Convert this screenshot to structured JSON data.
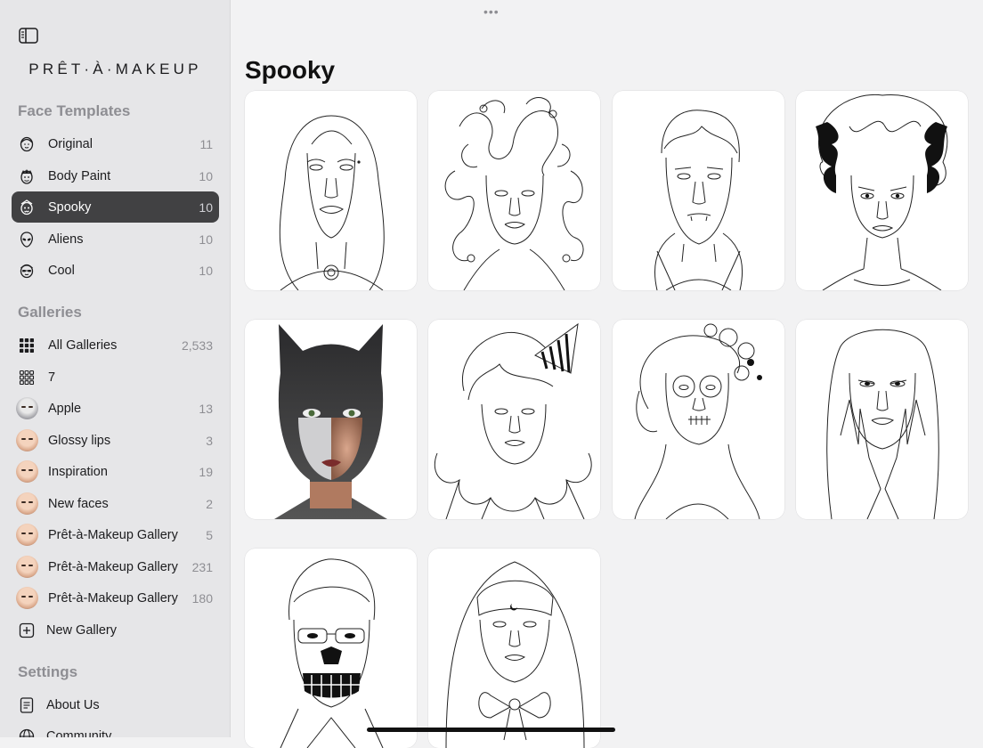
{
  "brand": "PRÊT-À-MAKEUP",
  "brand_display": "PRÊT·À·MAKEUP",
  "sections": {
    "face_templates": "Face Templates",
    "galleries": "Galleries",
    "settings": "Settings"
  },
  "face_templates": [
    {
      "label": "Original",
      "count": "11",
      "icon": "face-outline-icon"
    },
    {
      "label": "Body Paint",
      "count": "10",
      "icon": "body-paint-icon"
    },
    {
      "label": "Spooky",
      "count": "10",
      "icon": "spooky-face-icon",
      "selected": true
    },
    {
      "label": "Aliens",
      "count": "10",
      "icon": "alien-face-icon"
    },
    {
      "label": "Cool",
      "count": "10",
      "icon": "cool-face-icon"
    }
  ],
  "galleries": [
    {
      "label": "All Galleries",
      "count": "2,533",
      "icon": "grid-icon"
    },
    {
      "label": "7",
      "count": "",
      "icon": "grid-outline-icon"
    },
    {
      "label": "Apple",
      "count": "13",
      "icon": "avatar"
    },
    {
      "label": "Glossy lips",
      "count": "3",
      "icon": "avatar"
    },
    {
      "label": "Inspiration",
      "count": "19",
      "icon": "avatar"
    },
    {
      "label": "New faces",
      "count": "2",
      "icon": "avatar"
    },
    {
      "label": "Prêt-à-Makeup Gallery",
      "count": "5",
      "icon": "avatar"
    },
    {
      "label": "Prêt-à-Makeup Gallery",
      "count": "231",
      "icon": "avatar"
    },
    {
      "label": "Prêt-à-Makeup Gallery",
      "count": "180",
      "icon": "avatar"
    }
  ],
  "new_gallery": "New Gallery",
  "settings": [
    {
      "label": "About Us",
      "icon": "document-icon"
    },
    {
      "label": "Community",
      "icon": "globe-icon"
    }
  ],
  "main": {
    "title": "Spooky",
    "more_label": "•••",
    "templates": [
      {
        "name": "vampire-woman"
      },
      {
        "name": "medusa"
      },
      {
        "name": "vampire-man"
      },
      {
        "name": "bride-of-frankenstein"
      },
      {
        "name": "cat-skull-makeup"
      },
      {
        "name": "clown"
      },
      {
        "name": "sugar-skull"
      },
      {
        "name": "witch-claws"
      },
      {
        "name": "skeleton-man"
      },
      {
        "name": "hooded-girl"
      }
    ]
  },
  "colors": {
    "selected_row": "#414143",
    "sidebar_bg": "#e6e6e8",
    "main_bg": "#f2f2f3",
    "section_title": "#8e8e93"
  }
}
